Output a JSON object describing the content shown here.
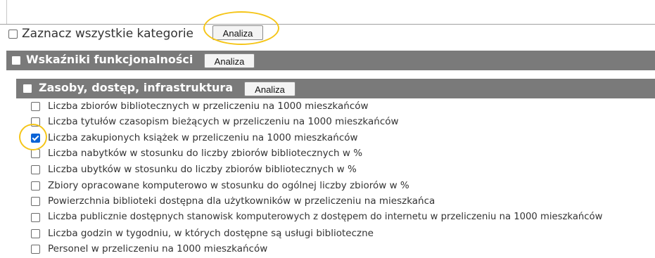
{
  "select_all": {
    "label": "Zaznacz wszystkie kategorie",
    "button": "Analiza",
    "checked": false
  },
  "section": {
    "label": "Wskaźniki funkcjonalności",
    "button": "Analiza"
  },
  "subsection": {
    "label": "Zasoby, dostęp, infrastruktura",
    "button": "Analiza"
  },
  "items": [
    {
      "label": "Liczba zbiorów bibliotecznych w przeliczeniu na 1000 mieszkańców",
      "checked": false
    },
    {
      "label": "Liczba tytułów czasopism bieżących w przeliczeniu na 1000 mieszkańców",
      "checked": false
    },
    {
      "label": "Liczba zakupionych książek w przeliczeniu na 1000 mieszkańców",
      "checked": true
    },
    {
      "label": "Liczba nabytków w stosunku do liczby zbiorów bibliotecznych w %",
      "checked": false
    },
    {
      "label": "Liczba ubytków w stosunku do liczby zbiorów bibliotecznych w %",
      "checked": false
    },
    {
      "label": "Zbiory opracowane komputerowo w stosunku do ogólnej liczby zbiorów w %",
      "checked": false
    },
    {
      "label": "Powierzchnia biblioteki dostępna dla użytkowników w przeliczeniu na mieszkańca",
      "checked": false
    },
    {
      "label": "Liczba publicznie dostępnych stanowisk komputerowych z dostępem do internetu w przeliczeniu na 1000 mieszkańców",
      "checked": false
    },
    {
      "label": "Liczba godzin w tygodniu, w których dostępne są usługi biblioteczne",
      "checked": false
    },
    {
      "label": "Personel w przeliczeniu na 1000 mieszkańców",
      "checked": false
    }
  ],
  "colors": {
    "header_bar": "#7a7a7a",
    "checkbox_checked": "#0b63d6",
    "highlight_ring": "#f5c518"
  }
}
